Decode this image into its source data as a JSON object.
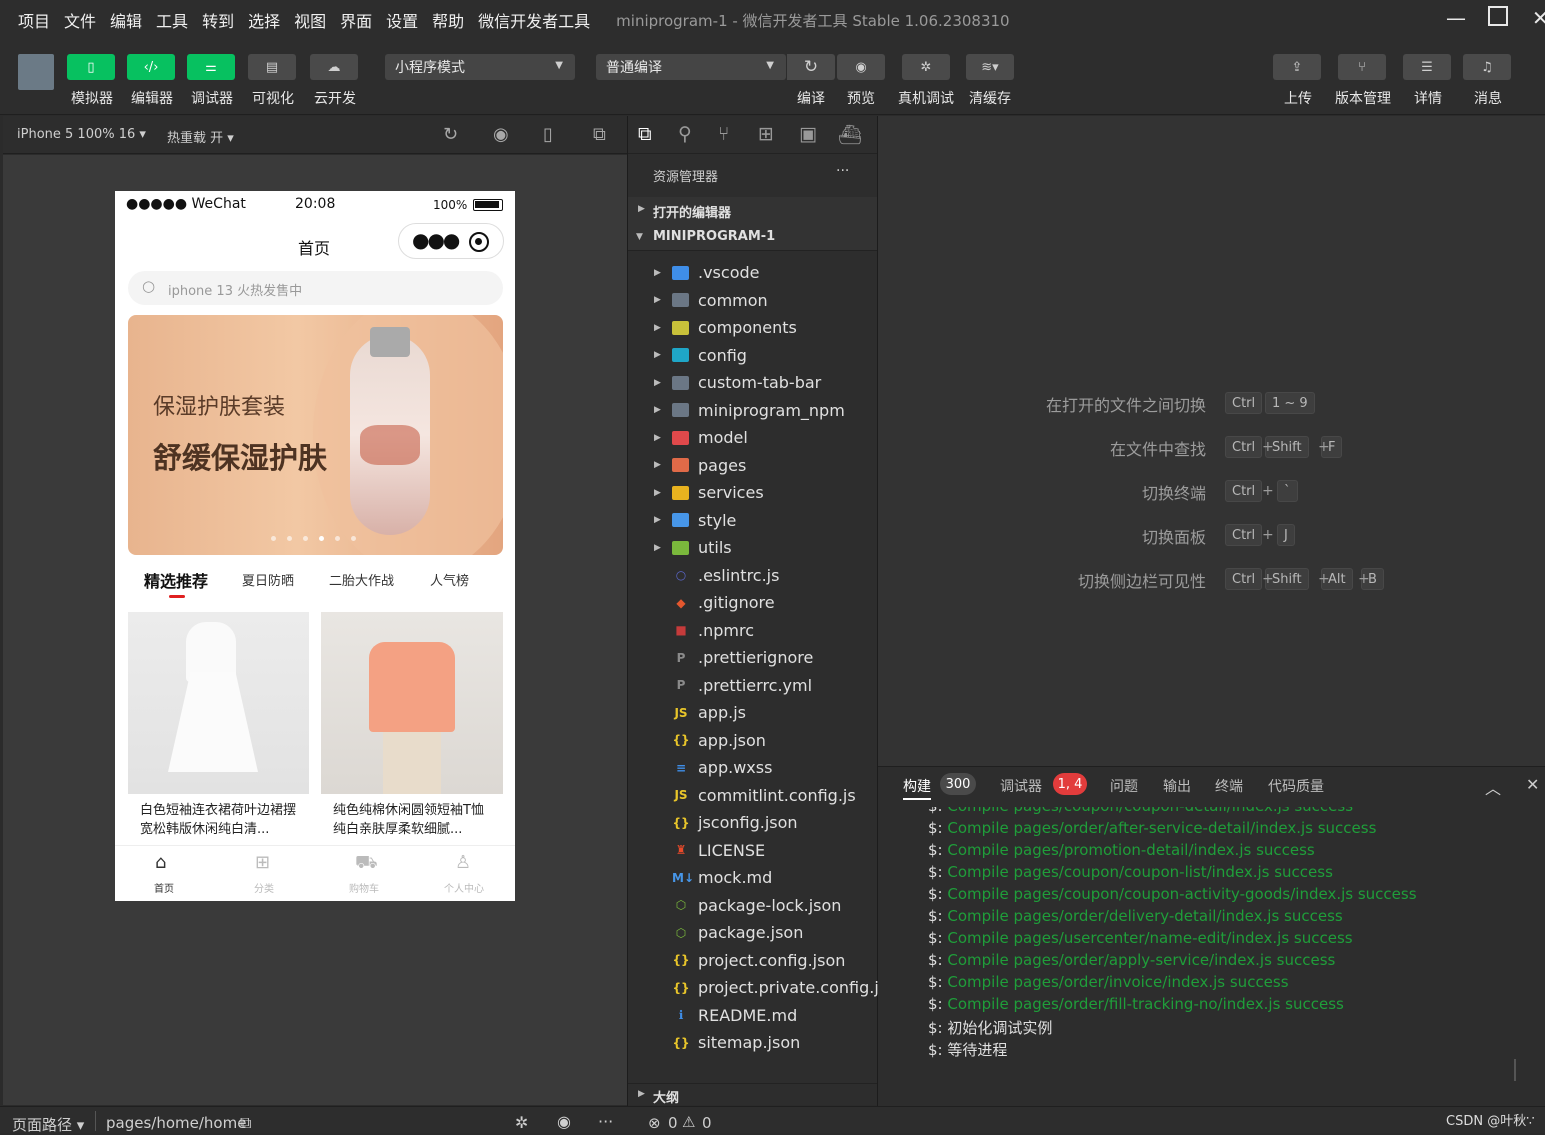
{
  "menubar": {
    "items": [
      "项目",
      "文件",
      "编辑",
      "工具",
      "转到",
      "选择",
      "视图",
      "界面",
      "设置",
      "帮助",
      "微信开发者工具"
    ],
    "title": "miniprogram-1 - 微信开发者工具 Stable 1.06.2308310"
  },
  "toolbar": {
    "left_buttons": [
      "模拟器",
      "编辑器",
      "调试器",
      "可视化",
      "云开发"
    ],
    "mode_select": "小程序模式",
    "compile_select": "普通编译",
    "mid_buttons": [
      "编译",
      "预览",
      "真机调试",
      "清缓存"
    ],
    "right_buttons": [
      "上传",
      "版本管理",
      "详情",
      "消息"
    ]
  },
  "simbar": {
    "device": "iPhone 5 100% 16 ▾",
    "hotreload": "热重载 开 ▾"
  },
  "phone": {
    "status": {
      "carrier": "●●●●● WeChat",
      "time": "20:08",
      "battery": "100%"
    },
    "nav_title": "首页",
    "search_placeholder": "iphone 13 火热发售中",
    "banner": {
      "line1": "保湿护肤套装",
      "line2": "舒缓保湿护肤"
    },
    "tabs": [
      "精选推荐",
      "夏日防晒",
      "二胎大作战",
      "人气榜"
    ],
    "products": [
      {
        "title": "白色短袖连衣裙荷叶边裙摆宽松韩版休闲纯白清..."
      },
      {
        "title": "纯色纯棉休闲圆领短袖T恤纯白亲肤厚柔软细腻..."
      }
    ],
    "tabbar": [
      "首页",
      "分类",
      "购物车",
      "个人中心"
    ]
  },
  "explorer": {
    "title": "资源管理器",
    "more": "···",
    "open_editors": "打开的编辑器",
    "project": "MINIPROGRAM-1",
    "folders": [
      ".vscode",
      "common",
      "components",
      "config",
      "custom-tab-bar",
      "miniprogram_npm",
      "model",
      "pages",
      "services",
      "style",
      "utils"
    ],
    "files": [
      ".eslintrc.js",
      ".gitignore",
      ".npmrc",
      ".prettierignore",
      ".prettierrc.yml",
      "app.js",
      "app.json",
      "app.wxss",
      "commitlint.config.js",
      "jsconfig.json",
      "LICENSE",
      "mock.md",
      "package-lock.json",
      "package.json",
      "project.config.json",
      "project.private.config.js...",
      "README.md",
      "sitemap.json"
    ],
    "outline": "大纲"
  },
  "shortcuts": [
    {
      "label": "在打开的文件之间切换",
      "keys": [
        "Ctrl",
        "1 ~ 9"
      ]
    },
    {
      "label": "在文件中查找",
      "keys": [
        "Ctrl",
        "Shift",
        "F"
      ]
    },
    {
      "label": "切换终端",
      "keys": [
        "Ctrl",
        "`"
      ]
    },
    {
      "label": "切换面板",
      "keys": [
        "Ctrl",
        "J"
      ]
    },
    {
      "label": "切换侧边栏可见性",
      "keys": [
        "Ctrl",
        "Shift",
        "Alt",
        "B"
      ]
    }
  ],
  "console": {
    "tabs": [
      {
        "label": "构建",
        "badge": "300"
      },
      {
        "label": "调试器",
        "badge": "1, 4"
      },
      {
        "label": "问题"
      },
      {
        "label": "输出"
      },
      {
        "label": "终端"
      },
      {
        "label": "代码质量"
      }
    ],
    "logs": [
      "Compile pages/coupon/coupon-detail/index.js success",
      "Compile pages/order/after-service-detail/index.js success",
      "Compile pages/promotion-detail/index.js success",
      "Compile pages/coupon/coupon-list/index.js success",
      "Compile pages/coupon/coupon-activity-goods/index.js success",
      "Compile pages/order/delivery-detail/index.js success",
      "Compile pages/usercenter/name-edit/index.js success",
      "Compile pages/order/apply-service/index.js success",
      "Compile pages/order/invoice/index.js success",
      "Compile pages/order/fill-tracking-no/index.js success"
    ],
    "prompt": "$:",
    "final_lines": [
      "初始化调试实例",
      "等待进程"
    ]
  },
  "statusbar": {
    "page_path_label": "页面路径 ▾",
    "page_path": "pages/home/home",
    "errors": "0",
    "warnings": "0",
    "watermark": "CSDN @叶秋∵"
  },
  "colors": {
    "accent_green": "#07c160",
    "log_green": "#1f9e3a",
    "badge_red": "#e23c3c",
    "tab_red": "#e02020"
  }
}
